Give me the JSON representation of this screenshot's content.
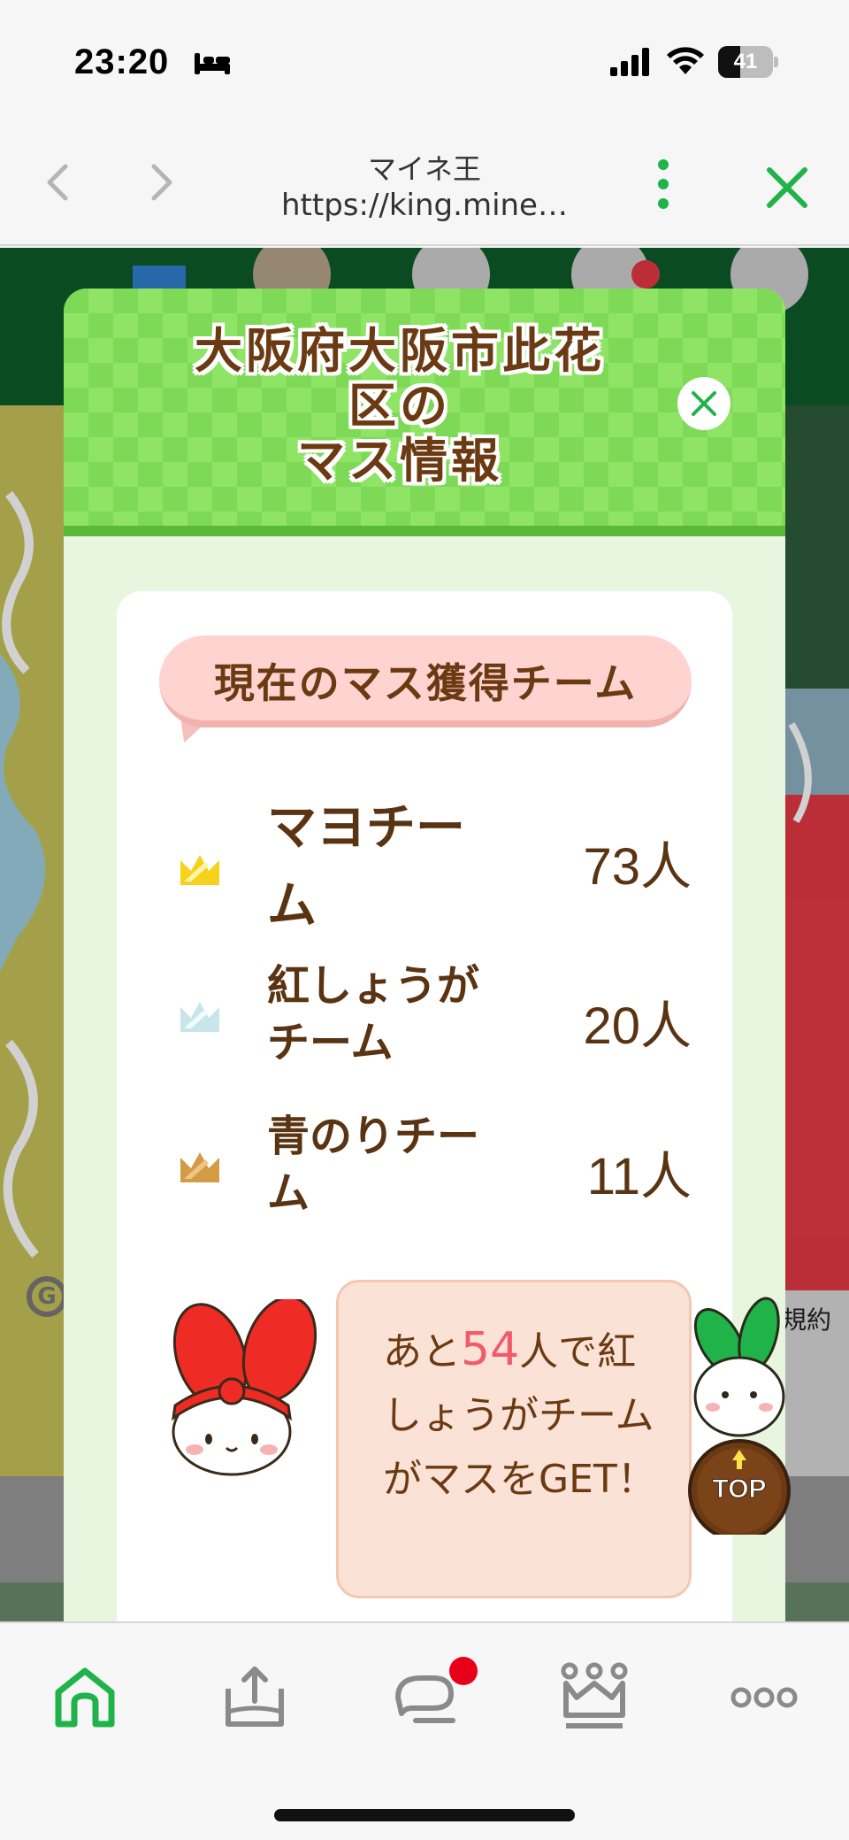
{
  "status_bar": {
    "time": "23:20",
    "battery_level": "41",
    "battery_fraction": 0.41,
    "icons": [
      "bed-icon",
      "signal-icon",
      "wifi-icon",
      "battery-icon"
    ]
  },
  "browser": {
    "title": "マイネ王",
    "url": "https://king.mine…",
    "icons": [
      "back-arrow-icon",
      "forward-arrow-icon",
      "menu-dots-icon",
      "close-icon"
    ],
    "accent_color": "#1fb34a"
  },
  "background_app": {
    "footer_link": "規約",
    "icons": [
      "google-g-icon"
    ]
  },
  "modal": {
    "title_line1": "大阪府大阪市此花",
    "title_line2": "区の",
    "title_line3": "マス情報",
    "close_icon": "close-icon",
    "header_color": "#7ed957",
    "title_color": "#6b3a12",
    "section_heading": "現在のマス獲得チーム",
    "teams": [
      {
        "name": "マヨチーム",
        "count": "73人",
        "crown": "gold-crown-icon",
        "crown_color": "#f6d21d"
      },
      {
        "name": "紅しょうがチーム",
        "count": "20人",
        "crown": "silver-crown-icon",
        "crown_color": "#c9e5ec"
      },
      {
        "name": "青のりチーム",
        "count": "11人",
        "crown": "bronze-crown-icon",
        "crown_color": "#d49b45"
      }
    ],
    "message": {
      "prefix": "あと",
      "number": "54",
      "suffix": "人で",
      "rest": "紅しょうがチームがマスをGET！",
      "number_color": "#f25a6b"
    },
    "mascot": "red-rabbit-mascot-icon"
  },
  "top_button": {
    "label": "TOP",
    "icon": "rabbit-top-icon"
  },
  "tab_bar": {
    "items": [
      {
        "name": "home",
        "icon": "home-icon",
        "active": true
      },
      {
        "name": "upload",
        "icon": "upload-icon",
        "active": false
      },
      {
        "name": "chat",
        "icon": "chat-icon",
        "active": false,
        "badge": true
      },
      {
        "name": "ranking",
        "icon": "crown-icon",
        "active": false
      },
      {
        "name": "more",
        "icon": "more-dots-icon",
        "active": false
      }
    ],
    "active_color": "#1fb34a",
    "badge_color": "#e8001a"
  }
}
